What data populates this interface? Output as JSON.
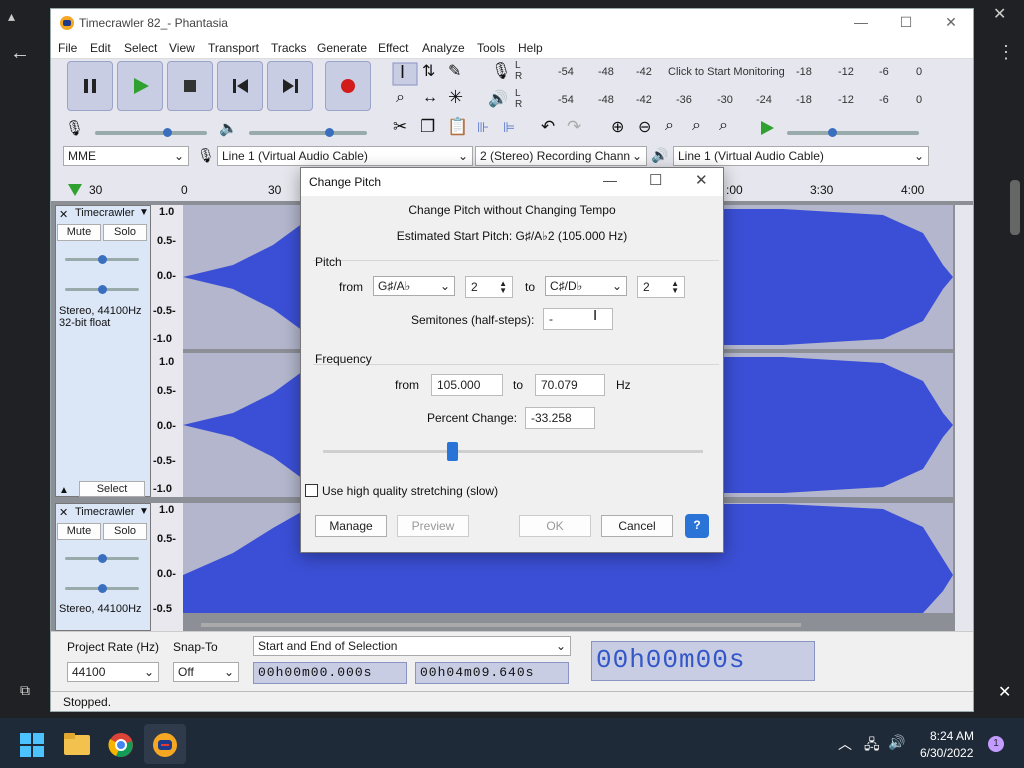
{
  "window": {
    "title": "Timecrawler 82_- Phantasia"
  },
  "menu": [
    "File",
    "Edit",
    "Select",
    "View",
    "Transport",
    "Tracks",
    "Generate",
    "Effect",
    "Analyze",
    "Tools",
    "Help"
  ],
  "meters": {
    "rec_ticks": [
      "-54",
      "-48",
      "-42",
      "Click to Start Monitoring",
      "-18",
      "-12",
      "-6",
      "0"
    ],
    "play_ticks": [
      "-54",
      "-48",
      "-42",
      "-36",
      "-30",
      "-24",
      "-18",
      "-12",
      "-6",
      "0"
    ],
    "rec_lr": [
      "L",
      "R"
    ],
    "play_lr": [
      "L",
      "R"
    ]
  },
  "devices": {
    "host": "MME",
    "rec_device": "Line 1 (Virtual Audio Cable)",
    "channels": "2 (Stereo) Recording Chann",
    "play_device": "Line 1 (Virtual Audio Cable)"
  },
  "timeline": {
    "ticks": [
      "30",
      "0",
      "30",
      ":00",
      "3:30",
      "4:00"
    ]
  },
  "tracks": [
    {
      "name": "Timecrawler",
      "mute": "Mute",
      "solo": "Solo",
      "info1": "Stereo, 44100Hz",
      "info2": "32-bit float",
      "select": "Select",
      "y_labels": [
        "1.0",
        "0.5-",
        "0.0-",
        "-0.5-",
        "-1.0",
        "1.0",
        "0.5-",
        "0.0-",
        "-0.5-",
        "-1.0"
      ]
    },
    {
      "name": "Timecrawler",
      "mute": "Mute",
      "solo": "Solo",
      "info1": "Stereo, 44100Hz",
      "y_labels": [
        "1.0",
        "0.5-",
        "0.0-",
        "-0.5"
      ]
    }
  ],
  "bottom": {
    "rate_label": "Project Rate (Hz)",
    "rate_value": "44100",
    "snap_label": "Snap-To",
    "snap_value": "Off",
    "sel_mode": "Start and End of Selection",
    "sel_start": "00h00m00.000s",
    "sel_end": "00h04m09.640s",
    "big_time": "00h00m00s"
  },
  "status": "Stopped.",
  "dialog": {
    "title": "Change Pitch",
    "heading": "Change Pitch without Changing Tempo",
    "estimated": "Estimated Start Pitch: G♯/A♭2 (105.000 Hz)",
    "pitch_group": "Pitch",
    "from_label": "from",
    "from_note": "G♯/A♭",
    "from_octave": "2",
    "to_label": "to",
    "to_note": "C♯/D♭",
    "to_octave": "2",
    "semitones_label": "Semitones (half-steps):",
    "semitones_value": "-",
    "freq_group": "Frequency",
    "freq_from_label": "from",
    "freq_from": "105.000",
    "freq_to_label": "to",
    "freq_to": "70.079",
    "hz": "Hz",
    "percent_label": "Percent Change:",
    "percent_value": "-33.258",
    "slider_percent": 0.34,
    "hq_label": "Use high quality stretching (slow)",
    "manage": "Manage",
    "preview": "Preview",
    "ok": "OK",
    "cancel": "Cancel",
    "help": "?"
  },
  "taskbar": {
    "time": "8:24 AM",
    "date": "6/30/2022",
    "badge": "1"
  },
  "colors": {
    "wave": "#3b4fd6",
    "accent": "#2a74d8",
    "play_green": "#2fa12f",
    "record_red": "#d21b1b"
  }
}
